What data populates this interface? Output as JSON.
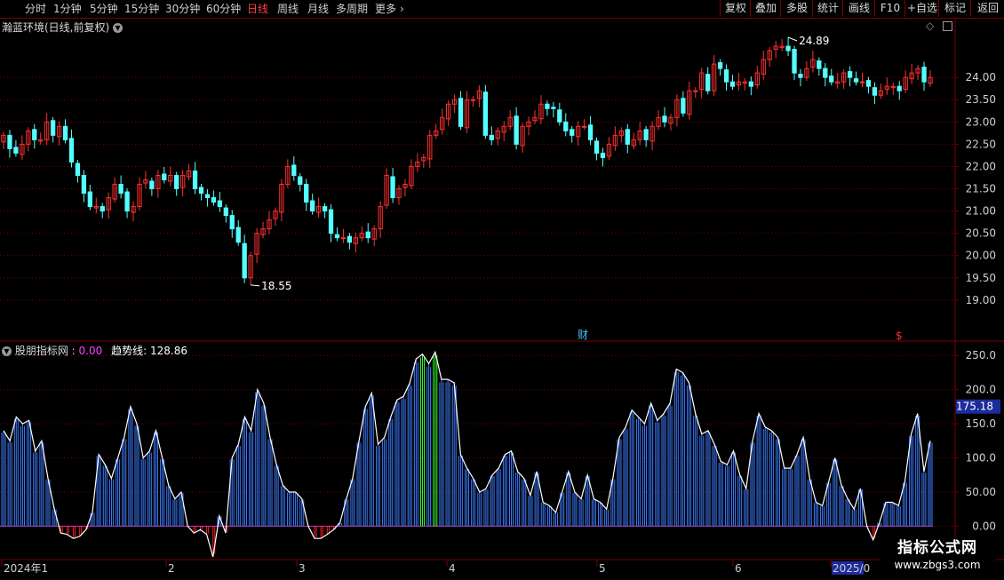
{
  "toolbar": {
    "periods": [
      {
        "label": "分时",
        "active": false
      },
      {
        "label": "1分钟",
        "active": false
      },
      {
        "label": "5分钟",
        "active": false
      },
      {
        "label": "15分钟",
        "active": false
      },
      {
        "label": "30分钟",
        "active": false
      },
      {
        "label": "60分钟",
        "active": false
      },
      {
        "label": "日线",
        "active": true
      },
      {
        "label": "周线",
        "active": false
      },
      {
        "label": "月线",
        "active": false
      },
      {
        "label": "多周期",
        "active": false
      },
      {
        "label": "更多",
        "active": false
      }
    ],
    "more_icon": "chevron-right-icon",
    "right_buttons": [
      "复权",
      "叠加",
      "多股",
      "统计",
      "画线",
      "F10",
      "+自选",
      "标记",
      "返回"
    ]
  },
  "main_chart": {
    "title": "瀚蓝环境(日线,前复权)",
    "title_icon": "chevron-down-circle-icon",
    "corner_icons": [
      "diamond-icon",
      "window-icon"
    ],
    "high_label": "24.89",
    "low_label": "18.55",
    "y_ticks": [
      "24.00",
      "23.50",
      "23.00",
      "22.50",
      "22.00",
      "21.50",
      "21.00",
      "20.50",
      "20.00",
      "19.50",
      "19.00"
    ],
    "markers": [
      {
        "text": "财",
        "color": "#40c8ff"
      },
      {
        "text": "$",
        "color": "#ff3030"
      }
    ]
  },
  "indicator": {
    "name": "股朋指标网",
    "name_value": "0.00",
    "line_label": "趋势线:",
    "line_value": "128.86",
    "y_ticks": [
      "250.0",
      "200.0",
      "150.0",
      "100.0",
      "50.00",
      "0.00"
    ],
    "current_tag": "175.18"
  },
  "x_axis": {
    "labels": [
      "2024年1",
      "2",
      "3",
      "4",
      "5",
      "6",
      "2025/0"
    ]
  },
  "watermark": {
    "title": "指标公式网",
    "url": "www.zbgs3.com"
  },
  "colors": {
    "up": "#ff3030",
    "down": "#54ffff",
    "grid": "#7a0000",
    "line": "#ffffff",
    "bar_pos": "#3c7cff",
    "bar_neg": "#ff2020",
    "highlight": "#30ff30",
    "tag_bg": "#1c2c9c"
  },
  "chart_data": [
    {
      "type": "candlestick",
      "title": "瀚蓝环境(日线,前复权)",
      "ylim": [
        18.3,
        25.0
      ],
      "y_ticks": [
        24.0,
        23.5,
        23.0,
        22.5,
        22.0,
        21.5,
        21.0,
        20.5,
        20.0,
        19.5,
        19.0
      ],
      "x_labels": [
        "2024年1",
        "2",
        "3",
        "4",
        "5",
        "6",
        "2025/0"
      ],
      "close": [
        22.7,
        22.4,
        22.3,
        22.5,
        22.8,
        22.6,
        22.6,
        23.0,
        22.7,
        22.9,
        22.6,
        22.1,
        21.8,
        21.4,
        21.1,
        21.1,
        21.0,
        21.3,
        21.6,
        21.4,
        21.0,
        21.1,
        21.6,
        21.7,
        21.5,
        21.8,
        21.7,
        21.8,
        21.5,
        21.8,
        21.9,
        21.5,
        21.4,
        21.3,
        21.2,
        21.1,
        20.9,
        20.6,
        20.3,
        19.5,
        20.0,
        20.5,
        20.6,
        20.8,
        21.0,
        21.6,
        22.0,
        21.8,
        21.6,
        21.2,
        21.0,
        21.1,
        21.0,
        20.5,
        20.4,
        20.4,
        20.3,
        20.4,
        20.5,
        20.4,
        20.6,
        21.1,
        21.8,
        21.3,
        21.5,
        21.6,
        22.0,
        22.1,
        22.2,
        22.7,
        22.8,
        23.1,
        23.4,
        23.5,
        22.9,
        23.5,
        23.5,
        23.7,
        22.7,
        22.6,
        22.8,
        22.9,
        23.1,
        22.5,
        22.9,
        23.0,
        23.1,
        23.4,
        23.3,
        23.3,
        23.0,
        22.8,
        22.7,
        22.9,
        22.9,
        22.6,
        22.3,
        22.2,
        22.5,
        22.7,
        22.8,
        22.5,
        22.6,
        22.8,
        22.6,
        22.9,
        23.1,
        23.0,
        23.1,
        23.5,
        23.2,
        23.7,
        23.7,
        24.1,
        23.7,
        24.3,
        24.2,
        23.9,
        23.8,
        23.9,
        23.9,
        23.8,
        24.1,
        24.4,
        24.6,
        24.7,
        24.7,
        24.6,
        24.1,
        24.0,
        24.2,
        24.4,
        24.2,
        24.0,
        23.9,
        23.9,
        24.1,
        24.0,
        23.9,
        23.9,
        23.8,
        23.6,
        23.7,
        23.8,
        23.8,
        23.7,
        24.0,
        24.1,
        24.2,
        23.9,
        24.0
      ]
    },
    {
      "type": "bar+line",
      "title": "股朋指标网",
      "series": [
        {
          "name": "趋势线",
          "last_value": 128.86
        }
      ],
      "ylim": [
        -45,
        262
      ],
      "y_ticks": [
        250,
        200,
        150,
        100,
        50,
        0
      ],
      "values": [
        140,
        125,
        160,
        150,
        155,
        110,
        125,
        70,
        25,
        -10,
        -12,
        -18,
        -15,
        -5,
        20,
        105,
        90,
        70,
        100,
        130,
        175,
        150,
        100,
        110,
        140,
        100,
        60,
        40,
        50,
        0,
        -10,
        -5,
        -12,
        -45,
        15,
        -10,
        100,
        120,
        160,
        140,
        200,
        180,
        130,
        90,
        60,
        50,
        50,
        40,
        0,
        -18,
        -18,
        -12,
        -5,
        5,
        40,
        70,
        125,
        175,
        195,
        120,
        130,
        160,
        185,
        190,
        210,
        245,
        252,
        238,
        255,
        215,
        215,
        210,
        105,
        85,
        70,
        50,
        55,
        75,
        85,
        105,
        110,
        80,
        70,
        45,
        80,
        35,
        30,
        20,
        50,
        80,
        50,
        40,
        75,
        40,
        35,
        25,
        70,
        130,
        145,
        170,
        160,
        150,
        180,
        155,
        165,
        180,
        230,
        225,
        210,
        165,
        135,
        140,
        120,
        95,
        90,
        110,
        75,
        55,
        125,
        165,
        145,
        140,
        130,
        85,
        85,
        105,
        130,
        70,
        35,
        30,
        65,
        100,
        60,
        40,
        25,
        55,
        0,
        -20,
        5,
        35,
        35,
        30,
        65,
        135,
        165,
        80,
        125
      ]
    }
  ]
}
